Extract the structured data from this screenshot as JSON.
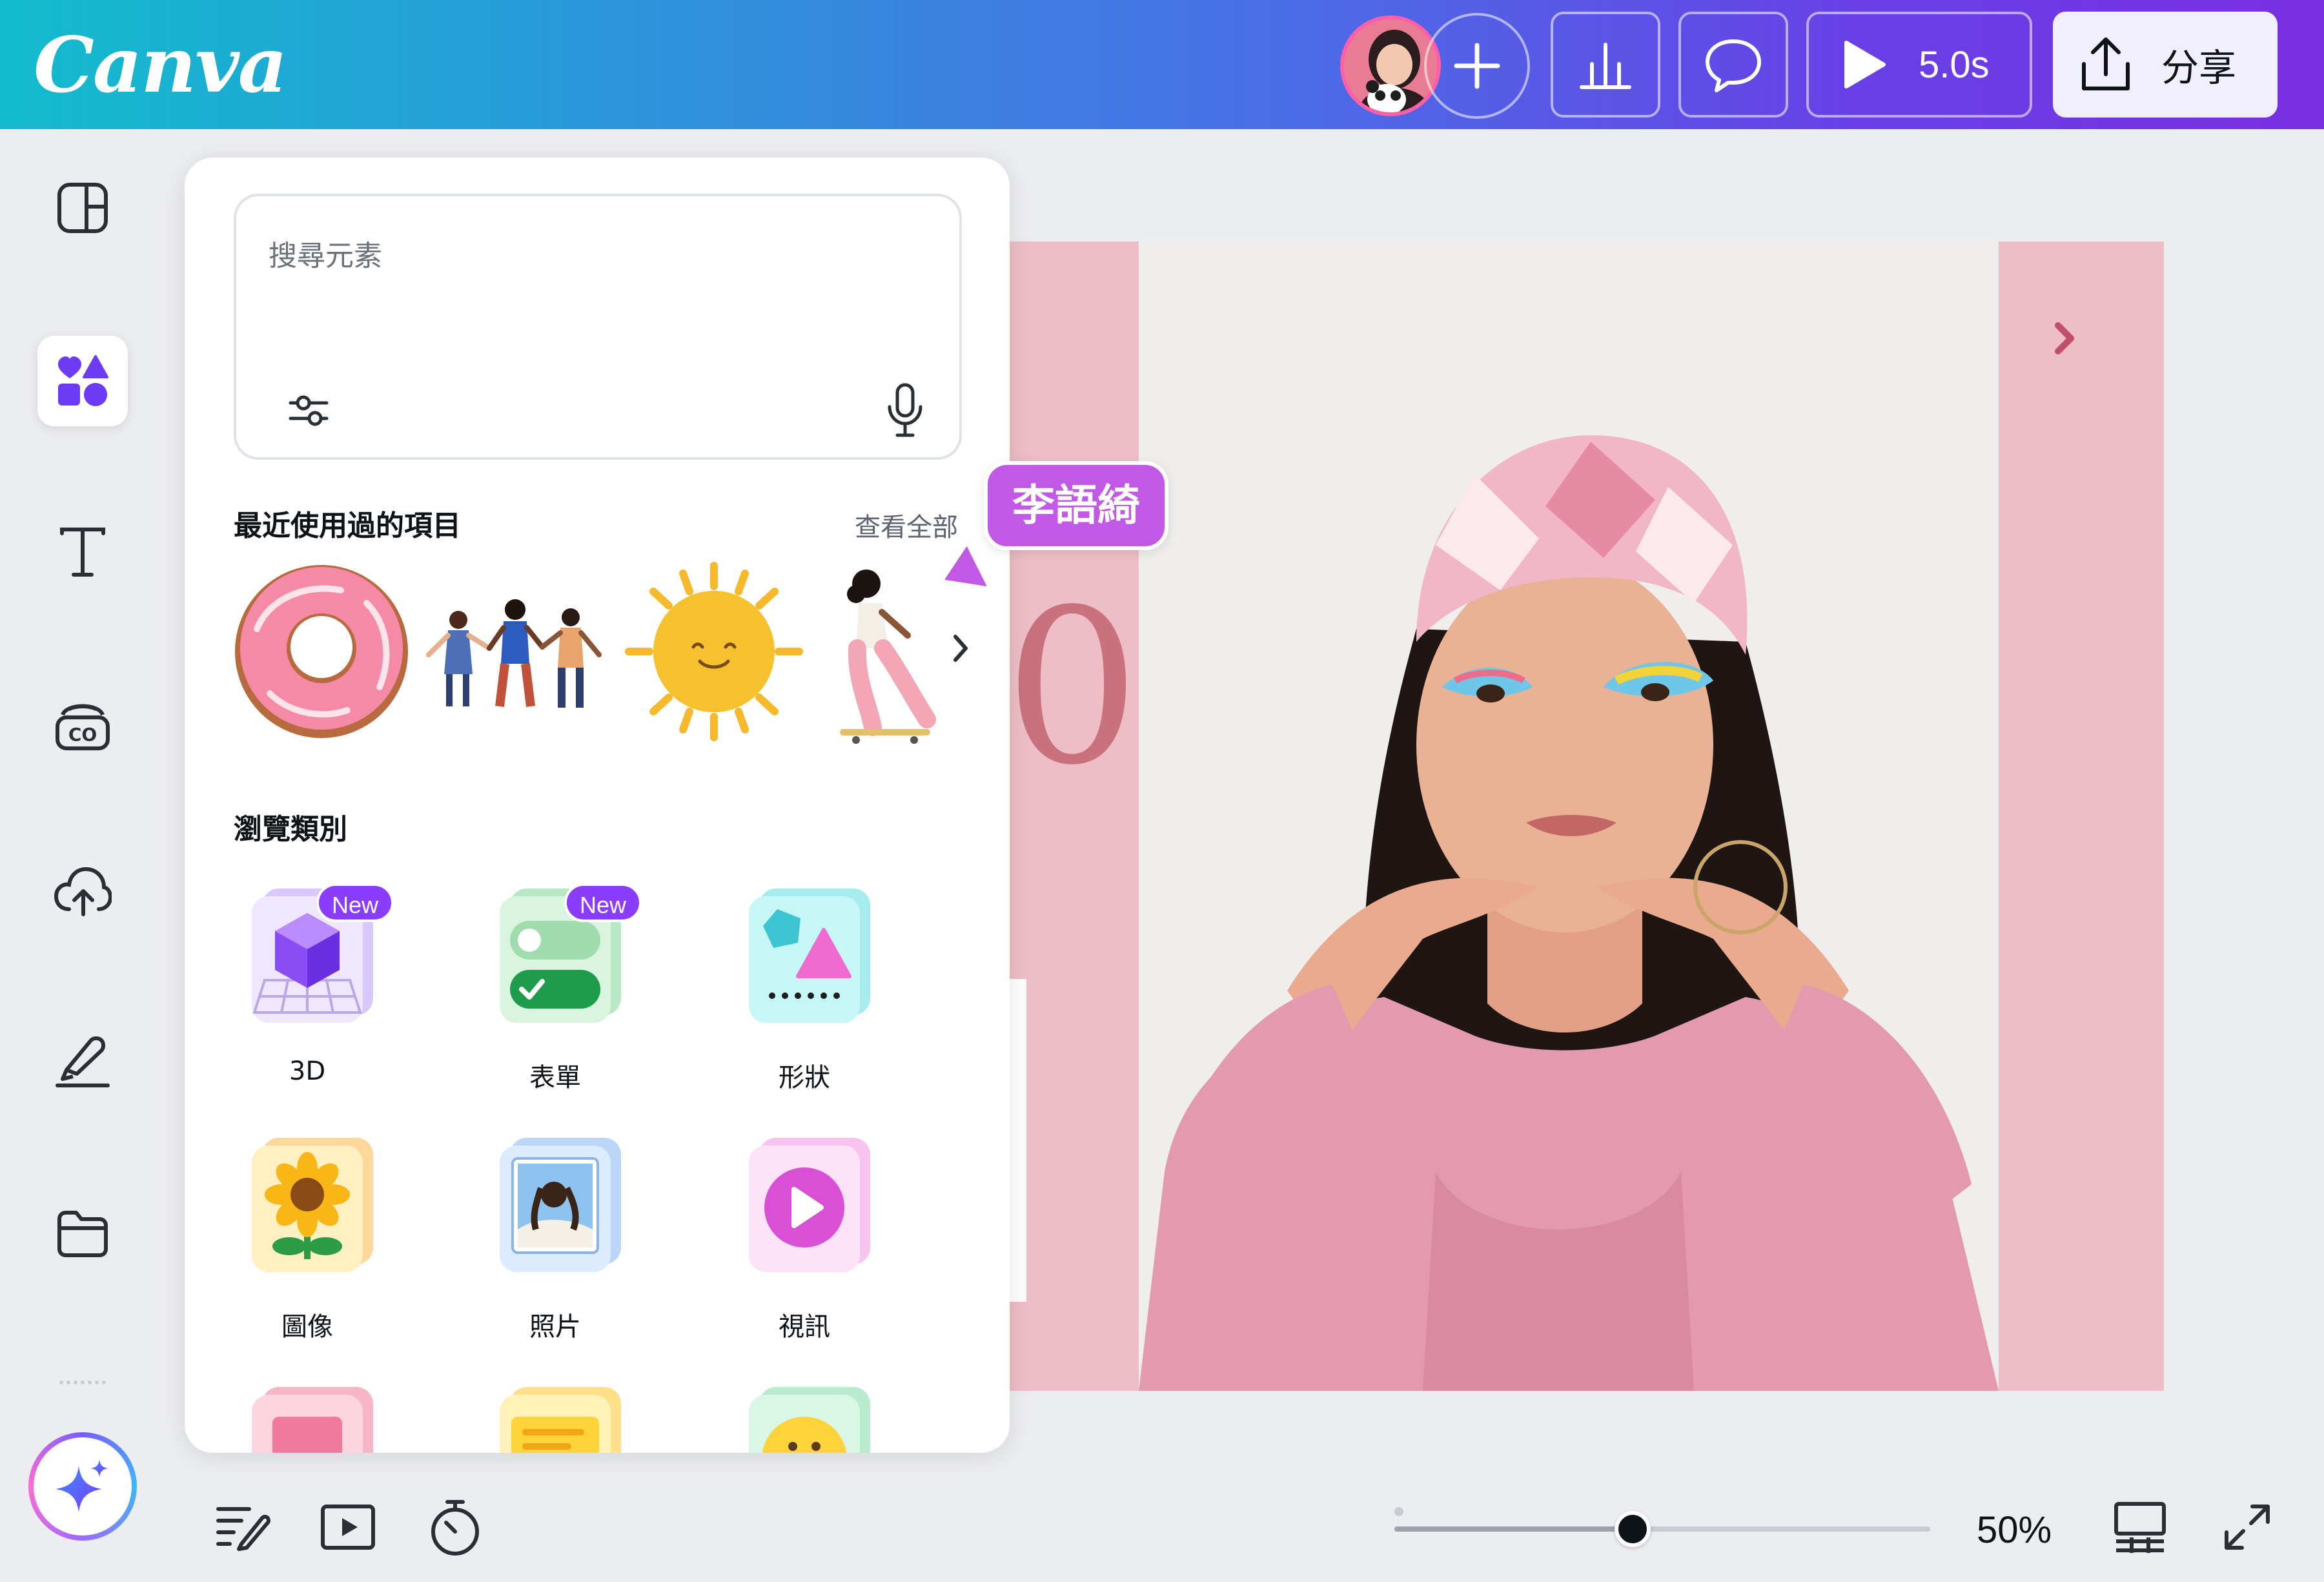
{
  "app": {
    "logo": "Canva",
    "brand_gradient": [
      "#12bccd",
      "#4a6ee6",
      "#7a2fe2"
    ],
    "accent": "#8b3dff"
  },
  "topbar": {
    "avatar_icon": "user-avatar",
    "add_icon": "plus-icon",
    "stats_icon": "bar-chart-icon",
    "comment_icon": "speech-bubble-icon",
    "play_icon": "play-icon",
    "play_duration": "5.0s",
    "share_icon": "upload-icon",
    "share_label": "分享"
  },
  "rail": {
    "items": [
      {
        "name": "design",
        "icon": "layout-icon",
        "active": false
      },
      {
        "name": "elements",
        "icon": "shapes-icon",
        "active": true
      },
      {
        "name": "text",
        "icon": "text-icon",
        "active": false
      },
      {
        "name": "brand",
        "icon": "brand-kit-icon",
        "active": false
      },
      {
        "name": "uploads",
        "icon": "cloud-upload-icon",
        "active": false
      },
      {
        "name": "draw",
        "icon": "pen-icon",
        "active": false
      },
      {
        "name": "projects",
        "icon": "folder-icon",
        "active": false
      }
    ],
    "magic_icon": "sparkle-icon"
  },
  "panel": {
    "search": {
      "placeholder": "搜尋元素",
      "value": ""
    },
    "recent": {
      "title": "最近使用過的項目",
      "see_all": "查看全部",
      "items": [
        "donut-sticker",
        "people-holding-hands",
        "smiling-sun",
        "skateboarder"
      ]
    },
    "browse": {
      "title": "瀏覽類別",
      "categories": [
        {
          "label": "3D",
          "new": true,
          "badge": "New"
        },
        {
          "label": "表單",
          "new": true,
          "badge": "New"
        },
        {
          "label": "形狀",
          "new": false
        },
        {
          "label": "圖像",
          "new": false
        },
        {
          "label": "照片",
          "new": false
        },
        {
          "label": "視訊",
          "new": false
        }
      ]
    }
  },
  "canvas": {
    "background": "#edbec6",
    "partial_number": "0",
    "collaborator": {
      "name": "李語綺",
      "color": "#c158e6"
    }
  },
  "bottombar": {
    "notes_icon": "notes-icon",
    "present_icon": "present-icon",
    "timer_icon": "timer-icon",
    "zoom_value": 50,
    "zoom_label": "50%",
    "grid_icon": "grid-view-icon",
    "fullscreen_icon": "fullscreen-icon"
  }
}
